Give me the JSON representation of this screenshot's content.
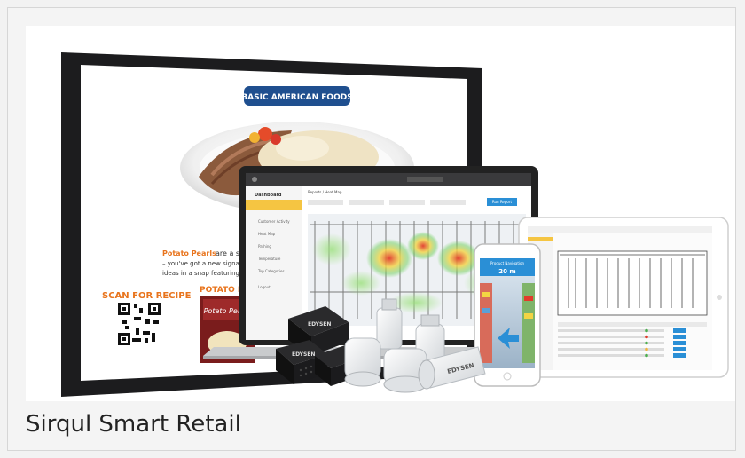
{
  "caption": "Sirqul Smart Retail",
  "image": {
    "brand_logo": "BASIC AMERICAN FOODS",
    "tablet_text": {
      "product": "Potato Pearls",
      "blurb_line1": "are a savory wa",
      "blurb_line2": "– you've got a new signature side c",
      "blurb_line3": "ideas in a snap featuring mashed p",
      "scan_label": "SCAN FOR RECIPE",
      "package_header": "POTATO PEA",
      "package_brand": "Potato Pearls"
    },
    "laptop_text": {
      "sidebar_header": "Dashboard",
      "breadcrumb": "Reports / Heat Map",
      "menu": [
        "Customer Activity",
        "Heat Map",
        "Pathing",
        "Temperature",
        "Top Categories",
        "Logout"
      ],
      "button": "Run Report"
    },
    "phone_text": {
      "title": "Product Navigation",
      "distance": "20 m"
    },
    "sensor_brand": "EDYSEN",
    "colors": {
      "brand_blue": "#1f4f8f",
      "accent_orange": "#e8741d",
      "device_dark": "#1c1c1e",
      "heat_red": "#e23b2b",
      "heat_yellow": "#f3d443",
      "heat_green": "#6fcf5a",
      "ui_blue": "#2a8fd6"
    }
  }
}
